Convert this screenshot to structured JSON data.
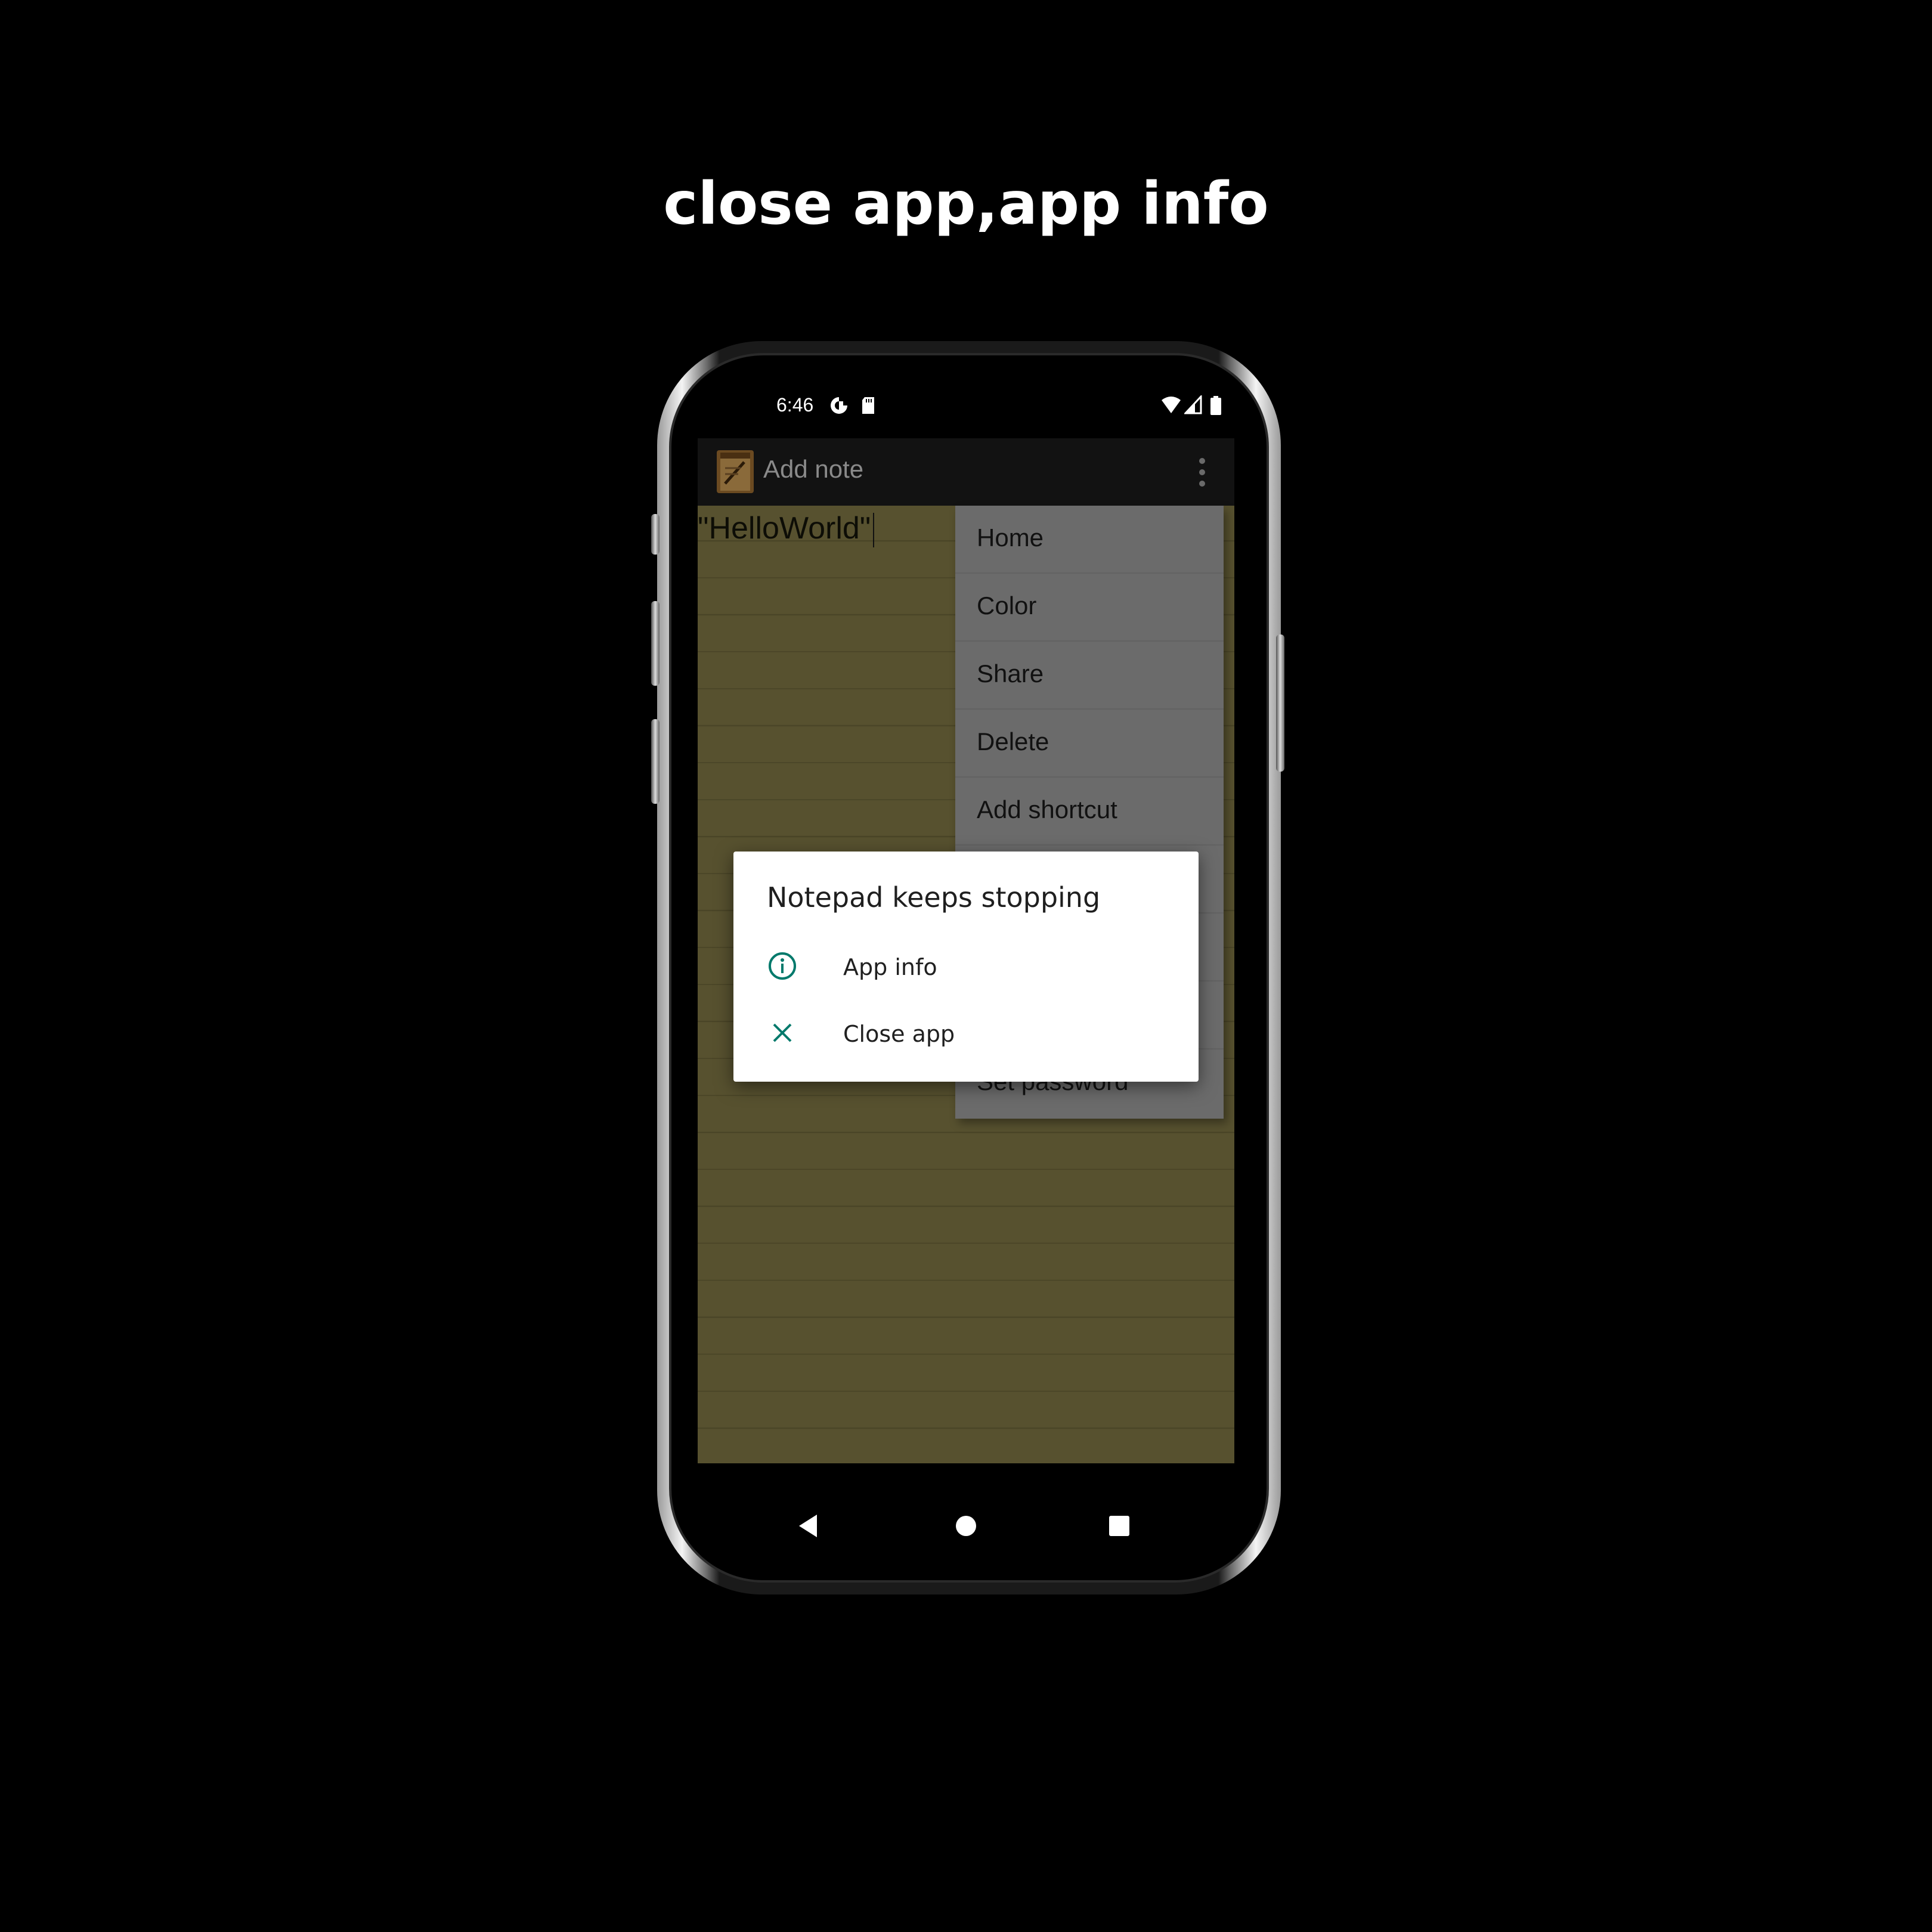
{
  "headline": "close app,app info",
  "status_bar": {
    "time": "6:46",
    "icons": [
      "vpn-icon",
      "sd-card-icon",
      "wifi-icon",
      "signal-icon",
      "battery-icon"
    ]
  },
  "app_bar": {
    "title": "Add note",
    "icon": "notepad-app-icon",
    "overflow_icon": "more-vert-icon"
  },
  "note": {
    "text": "\"HelloWorld\""
  },
  "menu": {
    "items": [
      {
        "label": "Home"
      },
      {
        "label": "Color"
      },
      {
        "label": "Share"
      },
      {
        "label": "Delete"
      },
      {
        "label": "Add shortcut"
      },
      {
        "label": ""
      },
      {
        "label": ""
      },
      {
        "label": ""
      },
      {
        "label": "Set password"
      }
    ]
  },
  "dialog": {
    "title": "Notepad keeps stopping",
    "items": [
      {
        "label": "App info",
        "icon": "info-icon"
      },
      {
        "label": "Close app",
        "icon": "close-icon"
      }
    ],
    "accent_color": "#00796b"
  },
  "nav_bar": {
    "buttons": [
      "back-icon",
      "home-icon",
      "recents-icon"
    ]
  },
  "colors": {
    "note_background": "#57512f",
    "menu_background": "#6b6b6b",
    "app_bar": "#121212"
  }
}
